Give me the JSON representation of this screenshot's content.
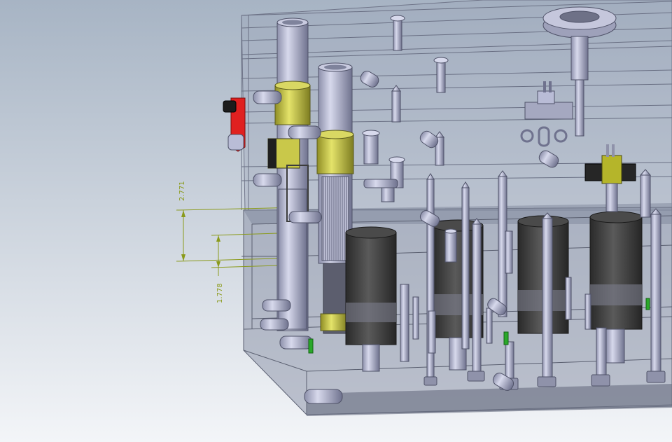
{
  "viewport": {
    "background_top": "#a7b4c4",
    "background_bottom": "#f3f5f8"
  },
  "dimensions": [
    {
      "id": "dim-upper",
      "text": "2.771"
    },
    {
      "id": "dim-lower",
      "text": "1.778"
    }
  ],
  "colors": {
    "dimension": "#8a9a1a",
    "steel": "#b9bcd6",
    "steel_dark": "#7f83a0",
    "bronze": "#c9c84a",
    "red_handle": "#e02020",
    "dark_body": "#3c3c3c",
    "green_pin": "#2aa82a",
    "yellow_block": "#b5b52a",
    "mold_plate": "#9aa0b4"
  }
}
